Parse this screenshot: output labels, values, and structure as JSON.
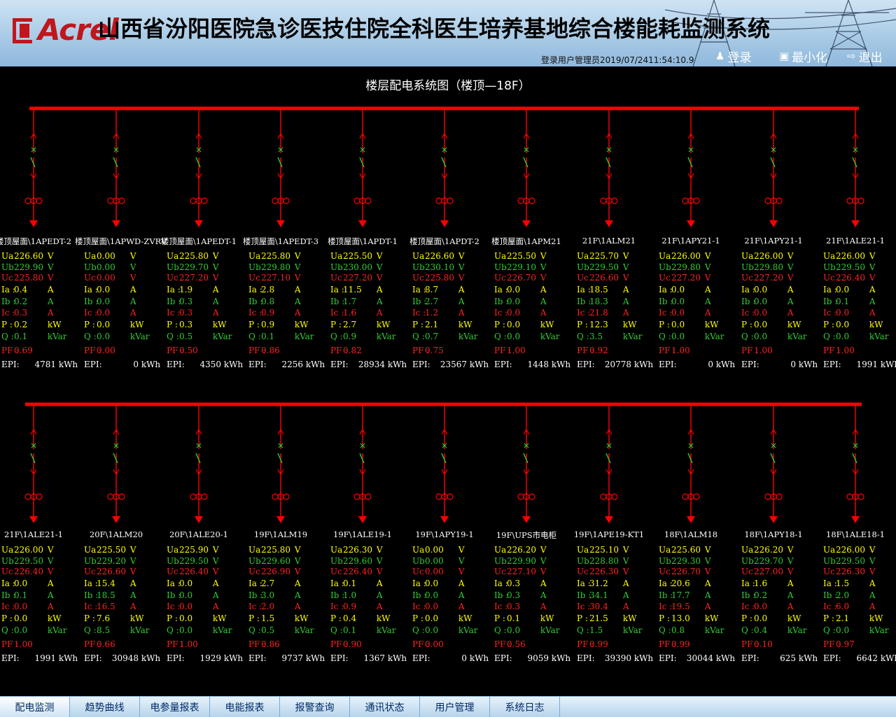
{
  "header": {
    "brand": "Acrel",
    "title": "山西省汾阳医院急诊医技住院全科医生培养基地综合楼能耗监测系统",
    "login_info": "登录用户管理员2019/07/2411:54:10.9",
    "buttons": [
      {
        "label": "登录",
        "icon": "user-icon"
      },
      {
        "label": "最小化",
        "icon": "minimize-icon"
      },
      {
        "label": "退出",
        "icon": "exit-icon"
      }
    ]
  },
  "diagram_title": "楼层配电系统图（楼顶—18F）",
  "colors": {
    "bus": "#ff0000",
    "label": "#ffff00",
    "ib": "#33cc33",
    "ic": "#ff2020",
    "text": "#ffffff"
  },
  "rows": [
    [
      {
        "name": "楼顶屋面\\1APEDT-2",
        "ua": "226.60",
        "ub": "229.90",
        "uc": "225.80",
        "ia": "0.4",
        "ib": "0.2",
        "ic": "0.3",
        "p": "0.2",
        "q": "0.1",
        "pf": "0.69",
        "epi": "4781"
      },
      {
        "name": "楼顶屋面\\1APWD-ZVRV",
        "ua": "0.00",
        "ub": "0.00",
        "uc": "0.00",
        "ia": "0.0",
        "ib": "0.0",
        "ic": "0.0",
        "p": "0.0",
        "q": "0.0",
        "pf": "0.00",
        "epi": "0"
      },
      {
        "name": "楼顶屋面\\1APEDT-1",
        "ua": "225.80",
        "ub": "229.70",
        "uc": "227.20",
        "ia": "1.9",
        "ib": "0.3",
        "ic": "0.3",
        "p": "0.3",
        "q": "0.5",
        "pf": "0.50",
        "epi": "4350"
      },
      {
        "name": "楼顶屋面\\1APEDT-3",
        "ua": "225.80",
        "ub": "229.80",
        "uc": "227.10",
        "ia": "2.8",
        "ib": "0.8",
        "ic": "0.9",
        "p": "0.9",
        "q": "0.1",
        "pf": "0.86",
        "epi": "2256"
      },
      {
        "name": "楼顶屋面\\1APDT-1",
        "ua": "225.50",
        "ub": "230.00",
        "uc": "227.20",
        "ia": "11.5",
        "ib": "1.7",
        "ic": "1.6",
        "p": "2.7",
        "q": "0.9",
        "pf": "0.82",
        "epi": "28934"
      },
      {
        "name": "楼顶屋面\\1APDT-2",
        "ua": "226.60",
        "ub": "230.10",
        "uc": "225.80",
        "ia": "8.7",
        "ib": "2.7",
        "ic": "1.2",
        "p": "2.1",
        "q": "0.7",
        "pf": "0.75",
        "epi": "23567"
      },
      {
        "name": "楼顶屋面\\1APM21",
        "ua": "225.50",
        "ub": "229.10",
        "uc": "226.70",
        "ia": "0.0",
        "ib": "0.0",
        "ic": "0.0",
        "p": "0.0",
        "q": "0.0",
        "pf": "1.00",
        "epi": "1448"
      },
      {
        "name": "21F\\1ALM21",
        "ua": "225.70",
        "ub": "229.50",
        "uc": "226.60",
        "ia": "18.5",
        "ib": "18.3",
        "ic": "21.8",
        "p": "12.3",
        "q": "3.5",
        "pf": "0.92",
        "epi": "20778"
      },
      {
        "name": "21F\\1APY21-1",
        "ua": "226.00",
        "ub": "229.80",
        "uc": "227.20",
        "ia": "0.0",
        "ib": "0.0",
        "ic": "0.0",
        "p": "0.0",
        "q": "0.0",
        "pf": "1.00",
        "epi": "0"
      },
      {
        "name": "21F\\1APY21-1",
        "ua": "226.00",
        "ub": "229.80",
        "uc": "227.20",
        "ia": "0.0",
        "ib": "0.0",
        "ic": "0.0",
        "p": "0.0",
        "q": "0.0",
        "pf": "1.00",
        "epi": "0"
      },
      {
        "name": "21F\\1ALE21-1",
        "ua": "226.00",
        "ub": "229.50",
        "uc": "226.40",
        "ia": "0.0",
        "ib": "0.1",
        "ic": "0.0",
        "p": "0.0",
        "q": "0.0",
        "pf": "1.00",
        "epi": "1991"
      }
    ],
    [
      {
        "name": "21F\\1ALE21-1",
        "ua": "226.00",
        "ub": "229.50",
        "uc": "226.40",
        "ia": "0.0",
        "ib": "0.1",
        "ic": "0.0",
        "p": "0.0",
        "q": "0.0",
        "pf": "1.00",
        "epi": "1991"
      },
      {
        "name": "20F\\1ALM20",
        "ua": "225.50",
        "ub": "229.20",
        "uc": "226.60",
        "ia": "15.4",
        "ib": "18.5",
        "ic": "16.5",
        "p": "7.6",
        "q": "8.5",
        "pf": "0.66",
        "epi": "30948"
      },
      {
        "name": "20F\\1ALE20-1",
        "ua": "225.90",
        "ub": "229.50",
        "uc": "226.40",
        "ia": "0.0",
        "ib": "0.0",
        "ic": "0.0",
        "p": "0.0",
        "q": "0.0",
        "pf": "1.00",
        "epi": "1929"
      },
      {
        "name": "19F\\1ALM19",
        "ua": "225.80",
        "ub": "229.60",
        "uc": "226.90",
        "ia": "2.7",
        "ib": "3.0",
        "ic": "2.0",
        "p": "1.5",
        "q": "0.5",
        "pf": "0.86",
        "epi": "9737"
      },
      {
        "name": "19F\\1ALE19-1",
        "ua": "226.30",
        "ub": "229.60",
        "uc": "226.40",
        "ia": "0.1",
        "ib": "1.0",
        "ic": "0.9",
        "p": "0.4",
        "q": "0.1",
        "pf": "0.90",
        "epi": "1367"
      },
      {
        "name": "19F\\1APY19-1",
        "ua": "0.00",
        "ub": "0.00",
        "uc": "0.00",
        "ia": "0.0",
        "ib": "0.0",
        "ic": "0.0",
        "p": "0.0",
        "q": "0.0",
        "pf": "0.00",
        "epi": "0"
      },
      {
        "name": "19F\\UPS市电柜",
        "ua": "226.20",
        "ub": "229.90",
        "uc": "227.10",
        "ia": "0.3",
        "ib": "0.3",
        "ic": "0.3",
        "p": "0.1",
        "q": "0.0",
        "pf": "0.56",
        "epi": "9059"
      },
      {
        "name": "19F\\1APE19-KT1",
        "ua": "225.10",
        "ub": "228.80",
        "uc": "226.30",
        "ia": "31.2",
        "ib": "34.1",
        "ic": "30.4",
        "p": "21.5",
        "q": "1.5",
        "pf": "0.99",
        "epi": "39390"
      },
      {
        "name": "18F\\1ALM18",
        "ua": "225.60",
        "ub": "229.30",
        "uc": "226.70",
        "ia": "20.6",
        "ib": "17.7",
        "ic": "19.5",
        "p": "13.0",
        "q": "0.8",
        "pf": "0.99",
        "epi": "30044"
      },
      {
        "name": "18F\\1APY18-1",
        "ua": "226.20",
        "ub": "229.70",
        "uc": "227.00",
        "ia": "1.6",
        "ib": "0.2",
        "ic": "0.0",
        "p": "0.0",
        "q": "0.4",
        "pf": "0.10",
        "epi": "625"
      },
      {
        "name": "18F\\1ALE18-1",
        "ua": "226.00",
        "ub": "229.50",
        "uc": "226.30",
        "ia": "1.5",
        "ib": "2.0",
        "ic": "6.0",
        "p": "2.1",
        "q": "0.0",
        "pf": "0.97",
        "epi": "6642"
      }
    ]
  ],
  "tabs": [
    "配电监测",
    "趋势曲线",
    "电参量报表",
    "电能报表",
    "报警查询",
    "通讯状态",
    "用户管理",
    "系统日志"
  ],
  "active_tab": 0
}
